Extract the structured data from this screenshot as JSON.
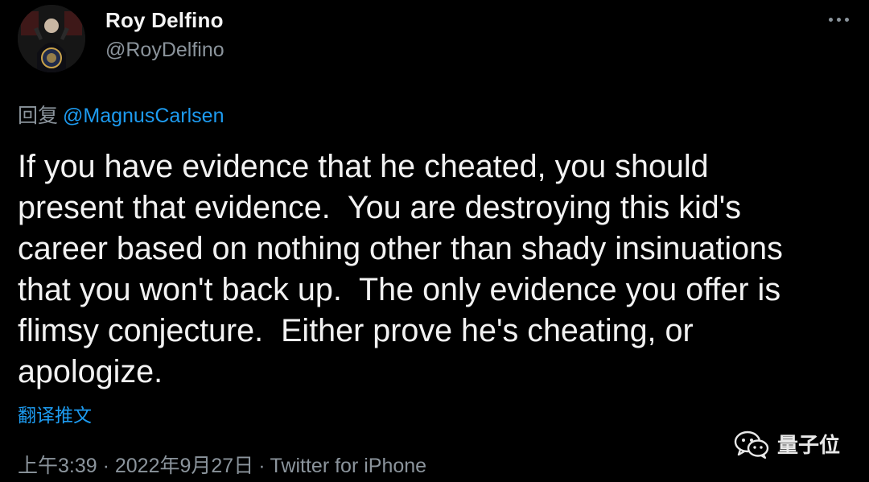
{
  "tweet": {
    "author": {
      "name": "Roy Delfino",
      "handle": "@RoyDelfino",
      "avatar_icon": "avatar-photo"
    },
    "reply": {
      "prefix": "回复",
      "mention": "@MagnusCarlsen"
    },
    "body": "If you have evidence that he cheated, you should\npresent that evidence.  You are destroying this kid's\ncareer based on nothing other than shady insinuations\nthat you won't back up.  The only evidence you offer is\nflimsy conjecture.  Either prove he's cheating, or\napologize.",
    "translate_label": "翻译推文",
    "timestamp": "上午3:39 · 2022年9月27日",
    "separator": "·",
    "source": "Twitter for iPhone",
    "more_icon": "more-dots-icon"
  },
  "watermark": {
    "text": "量子位",
    "icon": "wechat-icon"
  },
  "colors": {
    "background": "#000000",
    "text": "#f2f2f2",
    "muted": "#8b949c",
    "link": "#1d9bf0"
  }
}
